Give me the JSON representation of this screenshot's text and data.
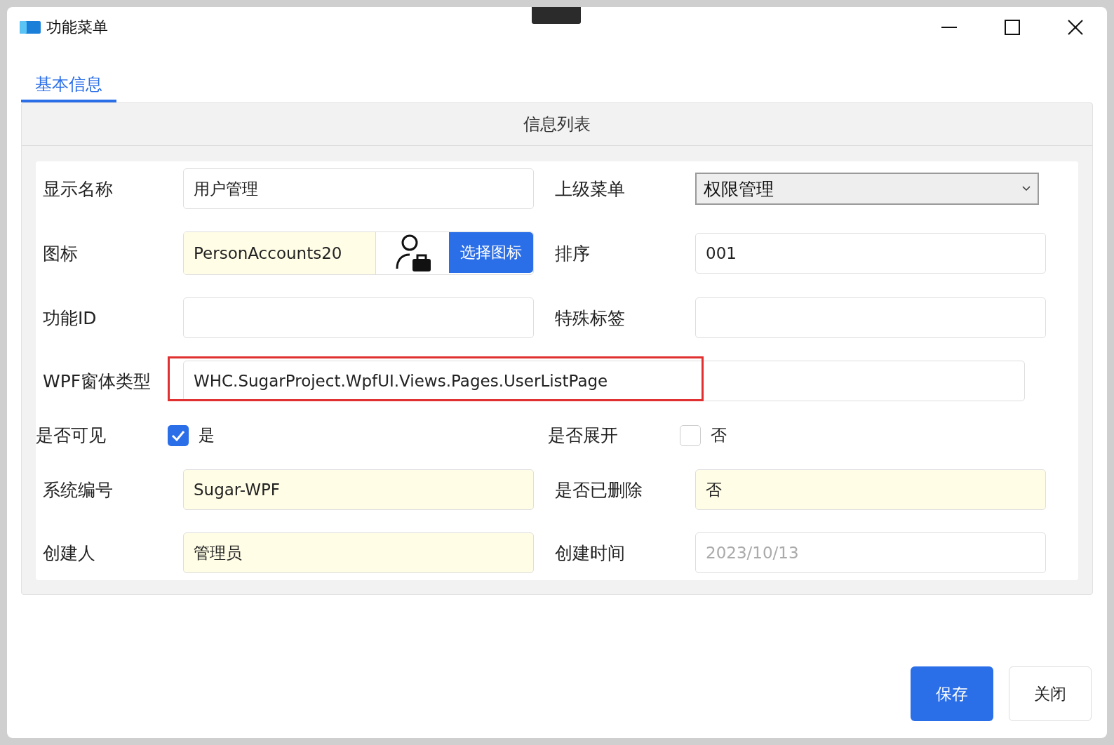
{
  "window": {
    "title": "功能菜单"
  },
  "tabs": [
    {
      "label": "基本信息",
      "selected": true
    }
  ],
  "panel": {
    "header": "信息列表"
  },
  "rows": [
    {
      "fields": [
        {
          "kind": "input",
          "label": "显示名称",
          "value": "用户管理"
        },
        {
          "kind": "select",
          "label": "上级菜单",
          "value": "权限管理"
        }
      ]
    },
    {
      "fields": [
        {
          "kind": "icon",
          "label": "图标",
          "value": "PersonAccounts20",
          "button": "选择图标"
        },
        {
          "kind": "input",
          "label": "排序",
          "value": "001"
        }
      ]
    },
    {
      "fields": [
        {
          "kind": "input",
          "label": "功能ID"
        },
        {
          "kind": "input",
          "label": "特殊标签"
        }
      ]
    },
    {
      "fields": [
        {
          "kind": "wide",
          "label": "WPF窗体类型",
          "value": "WHC.SugarProject.WpfUI.Views.Pages.UserListPage",
          "highlighted": true
        }
      ]
    },
    {
      "fields": [
        {
          "kind": "checkbox",
          "label": "是否可见",
          "checked": true,
          "text": "是"
        },
        {
          "kind": "checkbox",
          "label": "是否展开",
          "checked": false,
          "text": "否"
        }
      ]
    },
    {
      "fields": [
        {
          "kind": "readonly",
          "label": "系统编号",
          "value": "Sugar-WPF"
        },
        {
          "kind": "readonly",
          "label": "是否已删除",
          "value": "否"
        }
      ]
    },
    {
      "fields": [
        {
          "kind": "readonly",
          "label": "创建人",
          "value": "管理员"
        },
        {
          "kind": "disabled",
          "label": "创建时间",
          "value": "2023/10/13"
        }
      ]
    }
  ],
  "buttons": [
    {
      "label": "保存",
      "kind": "primary"
    },
    {
      "label": "关闭",
      "kind": "secondary"
    }
  ]
}
